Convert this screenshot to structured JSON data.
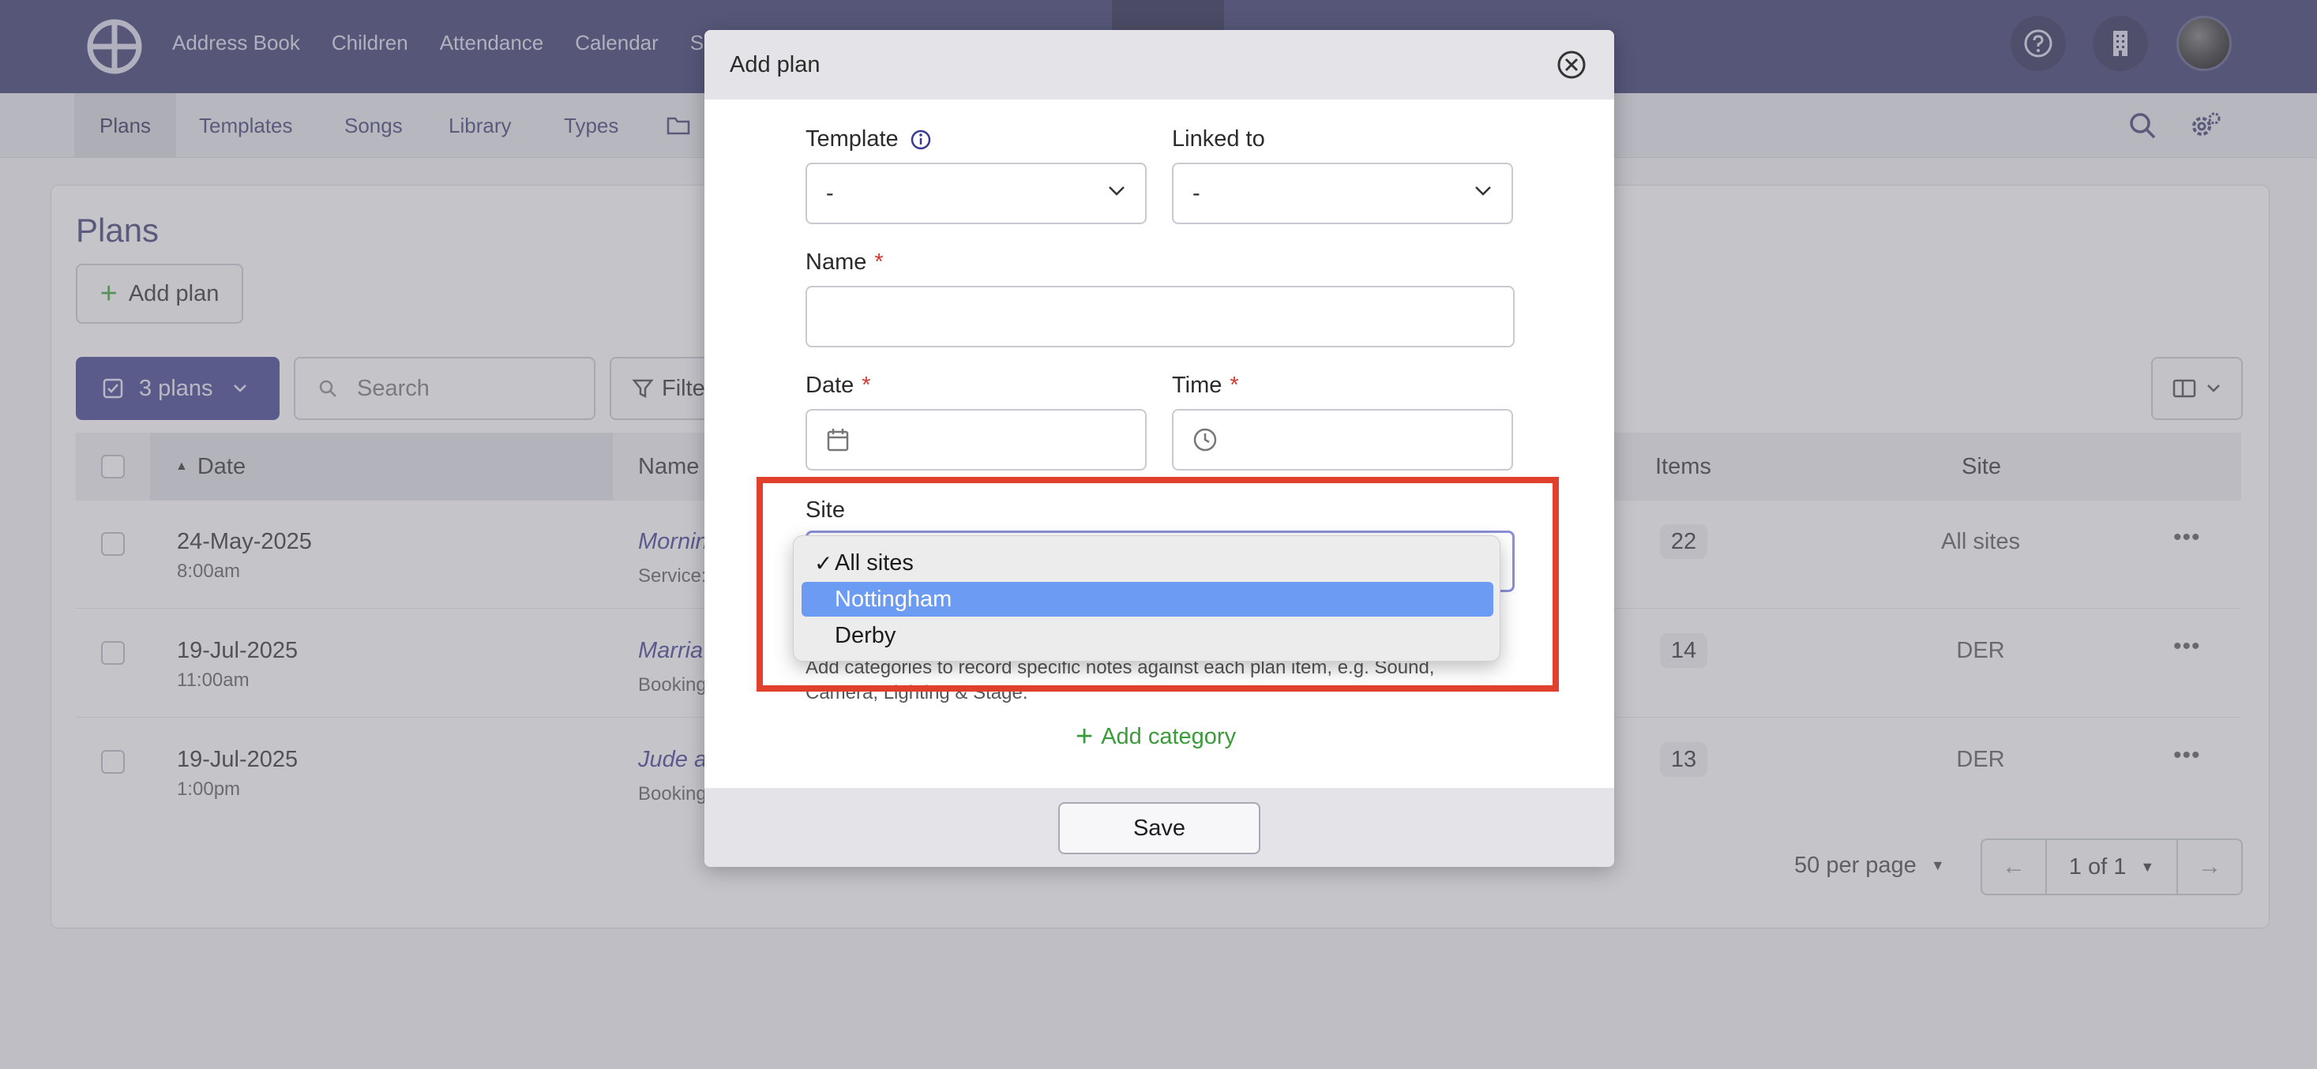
{
  "topnav": {
    "links": [
      "Address Book",
      "Children",
      "Attendance",
      "Calendar",
      "Se"
    ],
    "help_icon": "help-circle-icon",
    "org_icon": "building-icon"
  },
  "subnav": {
    "tabs": [
      "Plans",
      "Templates",
      "Songs",
      "Library",
      "Types"
    ],
    "folder_icon": "folder-icon"
  },
  "page": {
    "title": "Plans",
    "add_plan_label": "Add plan",
    "plans_count_label": "3 plans",
    "search_placeholder": "Search",
    "filter_label": "Filte"
  },
  "table": {
    "headers": {
      "date": "Date",
      "name": "Name",
      "items": "Items",
      "site": "Site"
    },
    "rows": [
      {
        "date": "24-May-2025",
        "time": "8:00am",
        "name": "Mornin",
        "type": "Service:",
        "items": "22",
        "site": "All sites"
      },
      {
        "date": "19-Jul-2025",
        "time": "11:00am",
        "name": "Marria",
        "type": "Booking",
        "items": "14",
        "site": "DER"
      },
      {
        "date": "19-Jul-2025",
        "time": "1:00pm",
        "name": "Jude ar",
        "type": "Booking",
        "items": "13",
        "site": "DER"
      }
    ]
  },
  "pagination": {
    "per_page": "50 per page",
    "page_label": "1 of 1"
  },
  "modal": {
    "title": "Add plan",
    "template_label": "Template",
    "template_value": "-",
    "linked_label": "Linked to",
    "linked_value": "-",
    "name_label": "Name",
    "required_mark": "*",
    "date_label": "Date",
    "time_label": "Time",
    "site_label": "Site",
    "hint": "Add categories to record specific notes against each plan item, e.g. Sound, Camera, Lighting & Stage.",
    "add_category": "Add category",
    "save": "Save"
  },
  "site_dropdown": {
    "options": [
      "All sites",
      "Nottingham",
      "Derby"
    ],
    "checked_option": "All sites",
    "highlighted_option": "Nottingham",
    "check_mark": "✓"
  },
  "colors": {
    "nav_bg": "#33336b",
    "accent": "#3a3a8c",
    "green": "#3a9b3a",
    "required": "#d03a2f",
    "highlight_box": "#e0402c",
    "dropdown_selected": "#6b9bf2"
  }
}
